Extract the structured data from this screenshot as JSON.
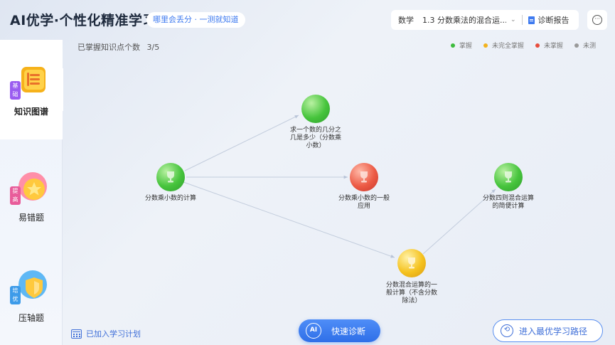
{
  "header": {
    "title": "AI优学·个性化精准学习",
    "slogan": "哪里会丢分 · 一测就知道",
    "subject": "数学",
    "chapter": "1.3 分数乘法的混合运...",
    "report_label": "诊断报告"
  },
  "sidebar": {
    "items": [
      {
        "label": "知识图谱",
        "tag": "基础",
        "active": true
      },
      {
        "label": "易错题",
        "tag": "提高",
        "active": false
      },
      {
        "label": "压轴题",
        "tag": "培优",
        "active": false
      }
    ]
  },
  "main": {
    "mastered_label": "已掌握知识点个数",
    "mastered_value": "3/5",
    "legend": [
      {
        "label": "掌握",
        "color": "#3dbb3d"
      },
      {
        "label": "未完全掌握",
        "color": "#f2b21d"
      },
      {
        "label": "未掌握",
        "color": "#e74c3c"
      },
      {
        "label": "未测",
        "color": "#999999"
      }
    ],
    "nodes": [
      {
        "label": "分数乘小数的计算",
        "status": "mastered"
      },
      {
        "label": "求一个数的几分之几是多少（分数乘小数）",
        "status": "mastered"
      },
      {
        "label": "分数乘小数的一般应用",
        "status": "not_mastered"
      },
      {
        "label": "分数混合运算的一般计算（不含分数除法）",
        "status": "partial"
      },
      {
        "label": "分数四则混合运算的简便计算",
        "status": "mastered"
      }
    ]
  },
  "footer": {
    "plan_label": "已加入学习计划",
    "diagnose_label": "快速诊断",
    "ai_text": "AI",
    "path_label": "进入最优学习路径"
  },
  "colors": {
    "mastered": "#3dbb3d",
    "partial": "#f2b21d",
    "not_mastered": "#e74c3c",
    "accent": "#3f7bf0"
  }
}
